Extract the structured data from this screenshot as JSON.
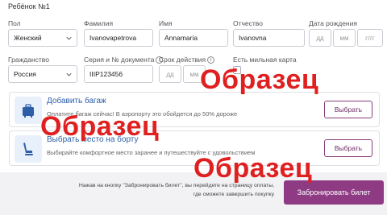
{
  "section_title": "Ребёнок №1",
  "labels": {
    "gender": "Пол",
    "last_name": "Фамилия",
    "first_name": "Имя",
    "patronymic": "Отчество",
    "birth_date": "Дата рождения",
    "citizenship": "Гражданство",
    "document": "Серия и № документа",
    "validity": "Срок действия",
    "mileage_card": "Есть мильная карта"
  },
  "fields": {
    "gender": "Женский",
    "last_name": "Ivanovapetrova",
    "first_name": "Annamaria",
    "patronymic": "Ivanovna",
    "citizenship": "Россия",
    "document": "IIIP123456"
  },
  "placeholders": {
    "day": "дд",
    "month": "мм",
    "year": "гггг"
  },
  "cards": {
    "baggage": {
      "title": "Добавить багаж",
      "subtitle": "Оплатите багаж сейчас! В аэропорту это обойдется до 50% дороже",
      "button": "Выбрать"
    },
    "seat": {
      "title": "Выбрать место на борту",
      "subtitle": "Выбирайте комфортное место заранее и путешествуйте с удовольствием",
      "button": "Выбрать"
    }
  },
  "footer": {
    "note": "Нажав на кнопку \"Забронировать билет\", вы перейдете на страницу оплаты, где сможете завершить покупку",
    "book_button": "Забронировать билет"
  },
  "watermark": "Образец",
  "colors": {
    "accent": "#8e3b84",
    "link": "#2c5fa8",
    "watermark": "#e02020"
  }
}
